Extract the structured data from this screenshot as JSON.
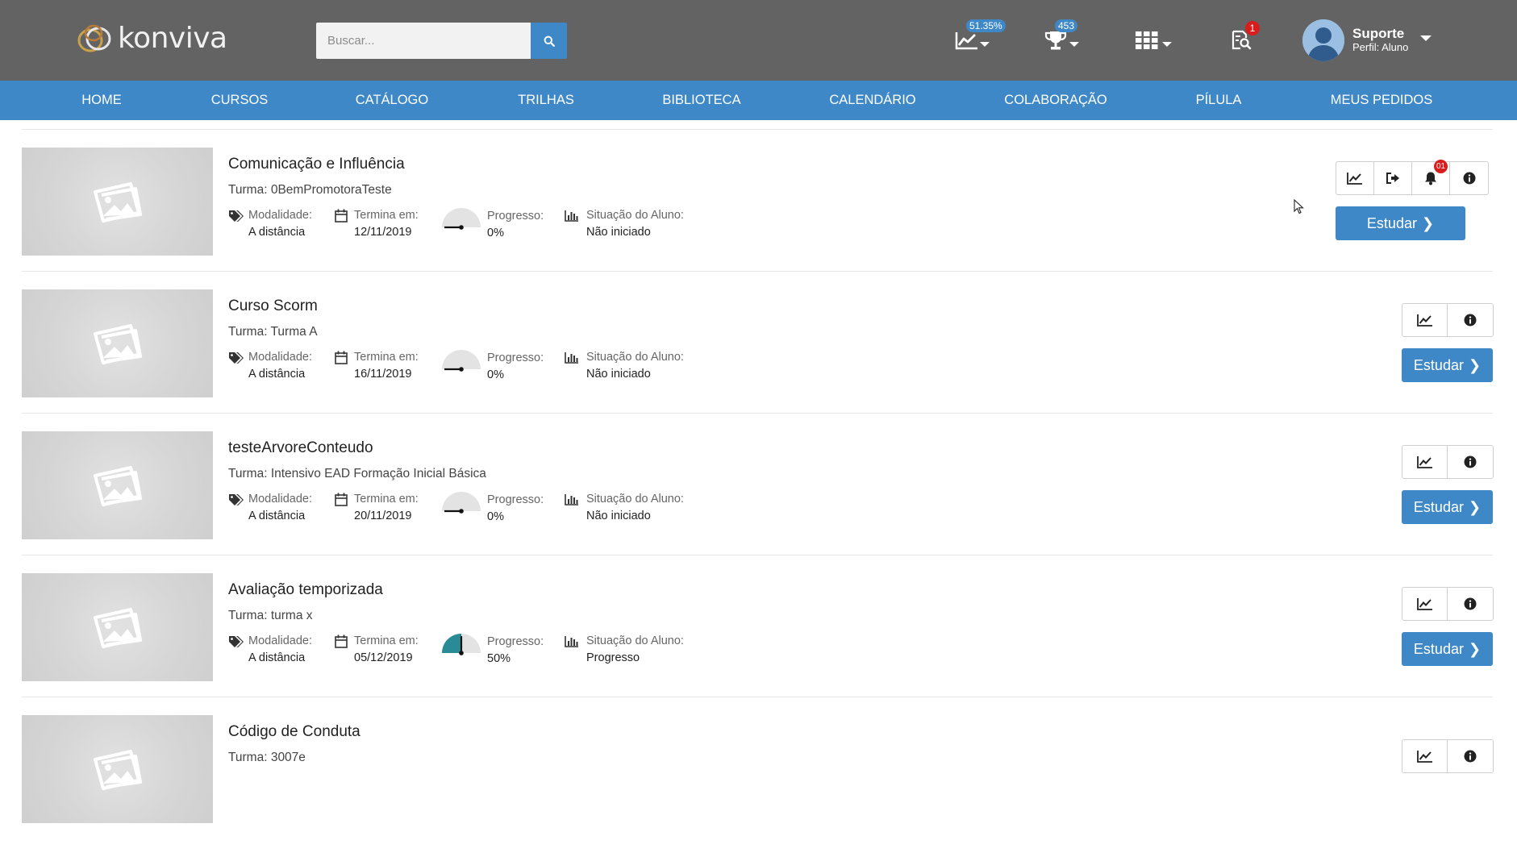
{
  "header": {
    "logo_text": "konviva",
    "search_placeholder": "Buscar...",
    "progress_badge": "51.35%",
    "trophy_badge": "453",
    "notifications_badge": "1",
    "user": {
      "name": "Suporte",
      "profile": "Perfil: Aluno"
    }
  },
  "nav": {
    "items": [
      "HOME",
      "CURSOS",
      "CATÁLOGO",
      "TRILHAS",
      "BIBLIOTECA",
      "CALENDÁRIO",
      "COLABORAÇÃO",
      "PÍLULA",
      "MEUS PEDIDOS"
    ]
  },
  "labels": {
    "modalidade": "Modalidade:",
    "termina": "Termina em:",
    "progresso": "Progresso:",
    "situacao": "Situação do Aluno:",
    "estudar": "Estudar"
  },
  "courses": [
    {
      "title": "Comunicação e Influência",
      "turma": "Turma: 0BemPromotoraTeste",
      "modalidade": "A distância",
      "termina": "12/11/2019",
      "progress_pct": 0,
      "progress_text": "0%",
      "situacao": "Não iniciado",
      "notification_badge": "01"
    },
    {
      "title": "Curso Scorm",
      "turma": "Turma: Turma A",
      "modalidade": "A distância",
      "termina": "16/11/2019",
      "progress_pct": 0,
      "progress_text": "0%",
      "situacao": "Não iniciado"
    },
    {
      "title": "testeArvoreConteudo",
      "turma": "Turma: Intensivo EAD Formação Inicial Básica",
      "modalidade": "A distância",
      "termina": "20/11/2019",
      "progress_pct": 0,
      "progress_text": "0%",
      "situacao": "Não iniciado"
    },
    {
      "title": "Avaliação temporizada",
      "turma": "Turma: turma x",
      "modalidade": "A distância",
      "termina": "05/12/2019",
      "progress_pct": 50,
      "progress_text": "50%",
      "situacao": "Progresso"
    },
    {
      "title": "Código de Conduta",
      "turma": "Turma: 3007e"
    }
  ],
  "colors": {
    "header_bg": "#636363",
    "nav_bg": "#3f88c8",
    "accent": "#3f88c8",
    "badge_red": "#d91c1c",
    "gauge_fill": "#2a8a96",
    "gauge_bg": "#e3e3e3"
  },
  "icons": {
    "search": "search-icon",
    "progress_chart": "line-chart-icon",
    "trophy": "trophy-icon",
    "apps": "grid-icon",
    "notifications": "search-document-icon",
    "tag": "tags-icon",
    "calendar": "calendar-icon",
    "bar_chart": "bar-chart-icon",
    "stats": "line-chart-icon",
    "exit": "sign-out-icon",
    "bell": "bell-icon",
    "info": "info-icon",
    "thumbnail": "image-placeholder-icon"
  }
}
